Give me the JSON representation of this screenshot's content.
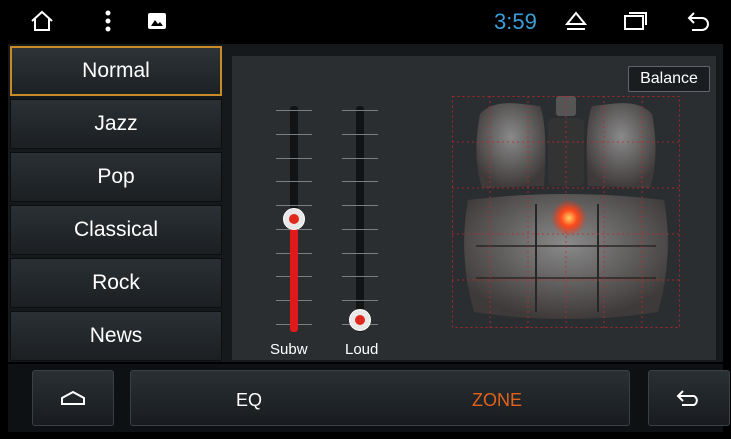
{
  "status_bar": {
    "time": "3:59",
    "icons": [
      "home-icon",
      "overflow-menu-icon",
      "image-icon",
      "eject-icon",
      "recent-apps-icon",
      "back-icon"
    ],
    "time_color": "#3a9fd6"
  },
  "presets": {
    "items": [
      {
        "label": "Normal",
        "selected": true
      },
      {
        "label": "Jazz",
        "selected": false
      },
      {
        "label": "Pop",
        "selected": false
      },
      {
        "label": "Classical",
        "selected": false
      },
      {
        "label": "Rock",
        "selected": false
      },
      {
        "label": "News",
        "selected": false
      }
    ],
    "selected_border_color": "#c98a2a"
  },
  "balance_button": {
    "label": "Balance"
  },
  "sliders": {
    "subw": {
      "label": "Subw",
      "level_fraction": 0.5,
      "fill_color": "#e01a1a"
    },
    "loud": {
      "label": "Loud",
      "level_fraction": 0.0
    }
  },
  "zone_map": {
    "image": "car-seats-top-view",
    "balance_point": "center",
    "marker_color": "#ff4a1a"
  },
  "bottom_bar": {
    "home_icon": "home-icon",
    "back_icon": "back-icon",
    "modes": [
      {
        "label": "EQ",
        "active": false
      },
      {
        "label": "ZONE",
        "active": true
      }
    ],
    "active_color": "#e2621c"
  }
}
